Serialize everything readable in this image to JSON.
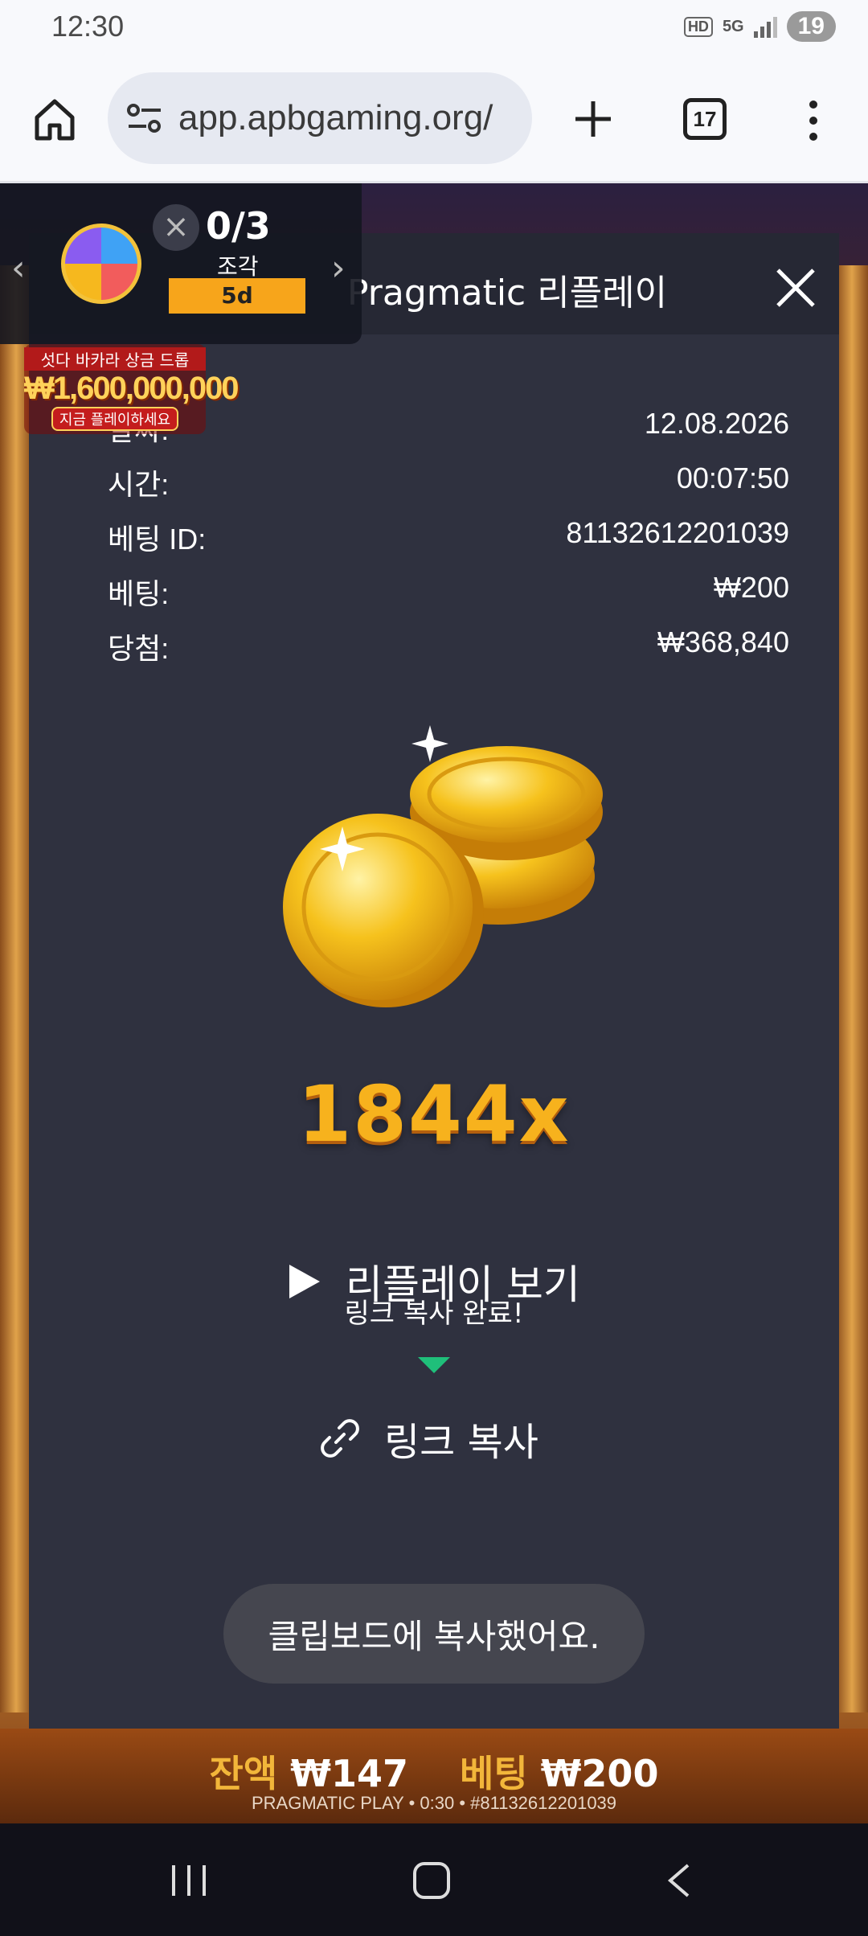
{
  "status_bar": {
    "time": "12:30",
    "hd_label": "HD",
    "network_label": "5G",
    "battery": "19"
  },
  "browser": {
    "url": "app.apbgaming.org/",
    "tab_count": "17"
  },
  "promo_widget": {
    "progress": "0/3",
    "piece_label": "조각",
    "days_left": "5d",
    "jackpot_title": "섯다 바카라 상금 드롭",
    "jackpot_amount": "₩1,600,000,000",
    "jackpot_cta": "지금 플레이하세요"
  },
  "modal": {
    "title": "Pragmatic 리플레이",
    "rows": [
      {
        "label": "날짜:",
        "value": "12.08.2026"
      },
      {
        "label": "시간:",
        "value": "00:07:50"
      },
      {
        "label": "베팅 ID:",
        "value": "81132612201039"
      },
      {
        "label": "베팅:",
        "value": "₩200"
      },
      {
        "label": "당첨:",
        "value": "₩368,840"
      }
    ],
    "multiplier": "1844x",
    "replay_label": "리플레이 보기",
    "copied_tooltip": "링크 복사 완료!",
    "copy_link_label": "링크 복사",
    "toast": "클립보드에 복사했어요.",
    "accent_color": "#1fbf7a"
  },
  "game_bar": {
    "balance_label": "잔액",
    "balance_value": "₩147",
    "bet_label": "베팅",
    "bet_value": "₩200",
    "footer": "PRAGMATIC PLAY • 0:30 • #81132612201039"
  }
}
